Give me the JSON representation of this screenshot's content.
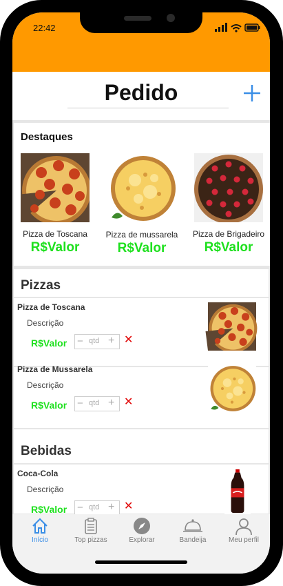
{
  "status": {
    "time": "22:42"
  },
  "header": {
    "title": "Pedido"
  },
  "highlights": {
    "title": "Destaques",
    "items": [
      {
        "name": "Pizza de Toscana",
        "price": "R$Valor",
        "image": "pepperoni-pizza"
      },
      {
        "name": "Pizza de mussarela",
        "price": "R$Valor",
        "image": "cheese-pizza"
      },
      {
        "name": "Pizza de Brigadeiro",
        "price": "R$Valor",
        "image": "chocolate-pizza"
      }
    ]
  },
  "pizzas": {
    "title": "Pizzas",
    "items": [
      {
        "name": "Pizza de Toscana",
        "description": "Descrição",
        "price": "R$Valor",
        "qty_placeholder": "qtd",
        "image": "pepperoni-pizza"
      },
      {
        "name": "Pizza de Mussarela",
        "description": "Descrição",
        "price": "R$Valor",
        "qty_placeholder": "qtd",
        "image": "cheese-pizza"
      }
    ]
  },
  "drinks": {
    "title": "Bebidas",
    "items": [
      {
        "name": "Coca-Cola",
        "description": "Descrição",
        "price": "R$Valor",
        "qty_placeholder": "qtd",
        "image": "cola-bottle"
      }
    ]
  },
  "tabbar": {
    "active": "Início",
    "items": [
      {
        "label": "Início",
        "icon": "home-icon"
      },
      {
        "label": "Top pizzas",
        "icon": "clipboard-icon"
      },
      {
        "label": "Explorar",
        "icon": "compass-icon"
      },
      {
        "label": "Bandeija",
        "icon": "cloche-icon"
      },
      {
        "label": "Meu perfil",
        "icon": "user-icon"
      }
    ]
  },
  "colors": {
    "status_bar": "#ff9900",
    "price": "#1ee01e",
    "accent": "#3a8ee6",
    "delete": "#e00000"
  }
}
